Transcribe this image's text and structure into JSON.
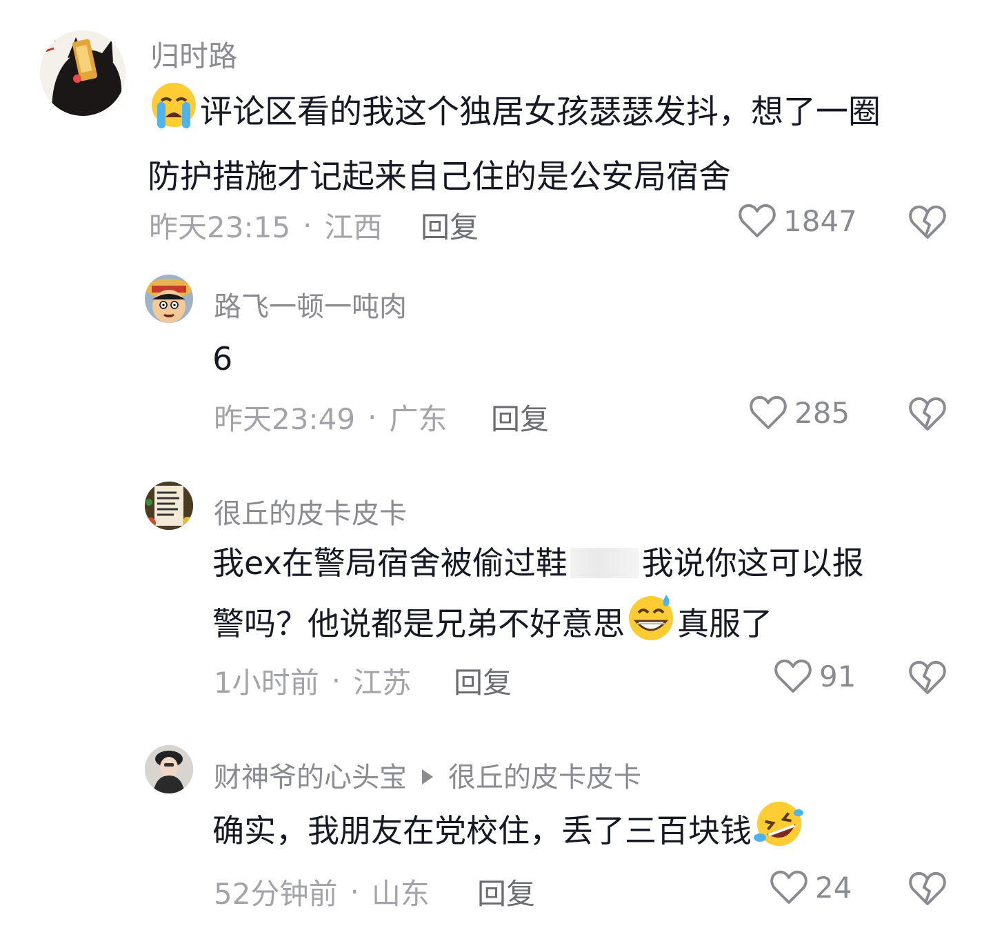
{
  "comments": [
    {
      "username": "归时路",
      "text_a": "评论区看的我这个独居女孩瑟瑟发抖，想了一圈",
      "text_b": "防护措施才记起来自己住的是公安局宿舍",
      "time": "昨天23:15",
      "location": "江西",
      "reply": "回复",
      "likes": "1847"
    },
    {
      "username": "路飞一顿一吨肉",
      "text_a": "6",
      "time": "昨天23:49",
      "location": "广东",
      "reply": "回复",
      "likes": "285"
    },
    {
      "username": "很丘的皮卡皮卡",
      "text_a": "我ex在警局宿舍被偷过鞋",
      "text_a2": "我说你这可以报",
      "text_b": "警吗？他说都是兄弟不好意思",
      "text_b2": "真服了",
      "time": "1小时前",
      "location": "江苏",
      "reply": "回复",
      "likes": "91"
    },
    {
      "username": "财神爷的心头宝",
      "reply_to": "很丘的皮卡皮卡",
      "text_a": "确实，我朋友在党校住，丢了三百块钱",
      "time": "52分钟前",
      "location": "山东",
      "reply": "回复",
      "likes": "24"
    }
  ],
  "separator": "·",
  "icons": {
    "like": "heart-outline-icon",
    "dislike": "broken-heart-icon",
    "emoji_1": "loudly-crying-emoji",
    "emoji_2": "grinning-sweat-emoji",
    "emoji_3": "rolling-laughing-emoji"
  },
  "colors": {
    "text": "#161823",
    "username": "#8a8b91",
    "meta": "#a3a4a9"
  }
}
